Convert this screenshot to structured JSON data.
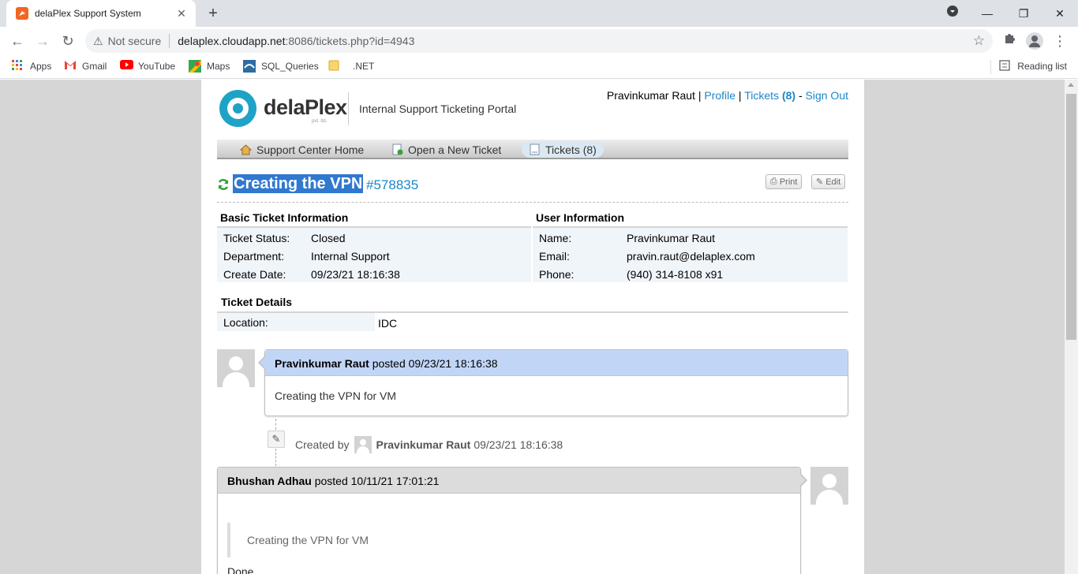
{
  "browser": {
    "tab_title": "delaPlex Support System",
    "security_label": "Not secure",
    "url_host": "delaplex.cloudapp.net",
    "url_rest": ":8086/tickets.php?id=4943",
    "bookmarks": [
      {
        "label": "Apps",
        "icon": "apps-grid-icon"
      },
      {
        "label": "Gmail",
        "icon": "gmail-icon"
      },
      {
        "label": "YouTube",
        "icon": "youtube-icon"
      },
      {
        "label": "Maps",
        "icon": "maps-icon"
      },
      {
        "label": "SQL_Queries",
        "icon": "sql-icon"
      },
      {
        "label": ".NET",
        "icon": "folder-icon"
      }
    ],
    "reading_list": "Reading list"
  },
  "header": {
    "logo_word": "delaPlex",
    "logo_sub": "pvt. ltd.",
    "portal_title": "Internal Support Ticketing Portal",
    "user_name": "Pravinkumar Raut",
    "profile_link": "Profile",
    "tickets_link": "Tickets",
    "tickets_count": "(8)",
    "signout_link": "Sign Out"
  },
  "nav": {
    "home": "Support Center Home",
    "open": "Open a New Ticket",
    "tickets": "Tickets (8)"
  },
  "ticket": {
    "title": "Creating the VPN",
    "number": "#578835",
    "print_label": "Print",
    "edit_label": "Edit"
  },
  "basic_info": {
    "heading": "Basic Ticket Information",
    "status_label": "Ticket Status:",
    "status_value": "Closed",
    "dept_label": "Department:",
    "dept_value": "Internal Support",
    "date_label": "Create Date:",
    "date_value": "09/23/21 18:16:38"
  },
  "user_info": {
    "heading": "User Information",
    "name_label": "Name:",
    "name_value": "Pravinkumar Raut",
    "email_label": "Email:",
    "email_value": "pravin.raut@delaplex.com",
    "phone_label": "Phone:",
    "phone_value": "(940) 314-8108 x91"
  },
  "details": {
    "heading": "Ticket Details",
    "location_label": "Location:",
    "location_value": "IDC"
  },
  "thread": {
    "msg1_author": "Pravinkumar Raut",
    "msg1_posted": "posted 09/23/21 18:16:38",
    "msg1_body": "Creating the VPN for VM",
    "event_prefix": "Created by",
    "event_author": "Pravinkumar Raut",
    "event_time": "09/23/21 18:16:38",
    "msg2_author": "Bhushan Adhau",
    "msg2_posted": "posted 10/11/21 17:01:21",
    "msg2_quote": "Creating the VPN for VM",
    "msg2_body": "Done"
  },
  "colors": {
    "accent_link": "#1a87c9",
    "logo": "#1ea3c7",
    "staff_header": "#c1d6f7",
    "user_header": "#dcdcdc"
  }
}
